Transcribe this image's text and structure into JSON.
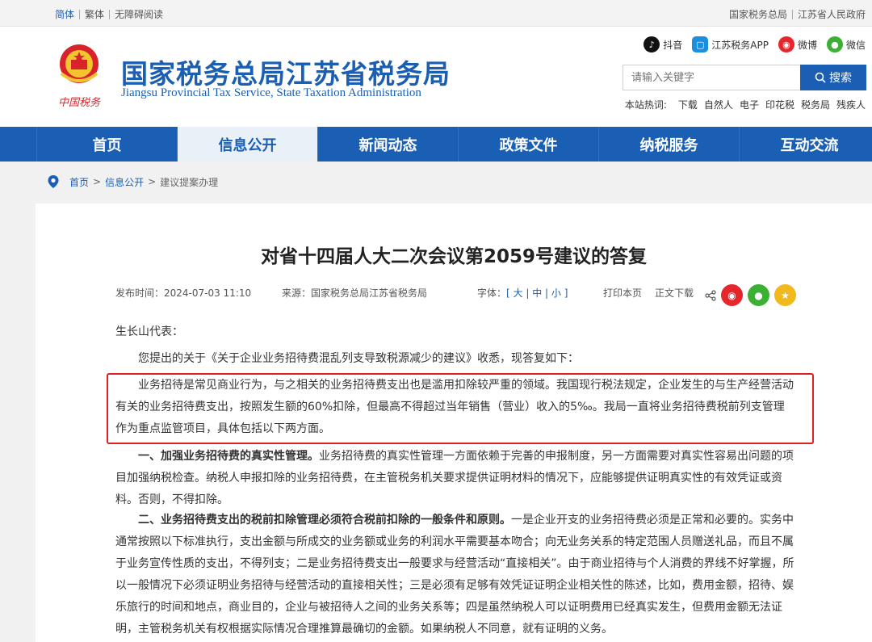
{
  "topbar": {
    "left": [
      "简体",
      "繁体",
      "无障碍阅读"
    ],
    "right": [
      "国家税务总局",
      "江苏省人民政府"
    ]
  },
  "header": {
    "emblem_caption": "中国税务",
    "title": "国家税务总局江苏省税务局",
    "subtitle": "Jiangsu Provincial Tax Service, State Taxation Administration",
    "social": [
      {
        "name": "抖音",
        "icon": "douyin-icon",
        "color": "#111111"
      },
      {
        "name": "江苏税务APP",
        "icon": "app-icon",
        "color": "#1a8fe0"
      },
      {
        "name": "微博",
        "icon": "weibo-icon",
        "color": "#e6262a"
      },
      {
        "name": "微信",
        "icon": "wechat-icon",
        "color": "#3cb034"
      }
    ],
    "search": {
      "placeholder": "请输入关键字",
      "button": "搜索"
    },
    "hot_label": "本站热词:",
    "hot_words": [
      "下载",
      "自然人",
      "电子",
      "印花税",
      "税务局",
      "残疾人"
    ]
  },
  "nav": {
    "items": [
      "首页",
      "信息公开",
      "新闻动态",
      "政策文件",
      "纳税服务",
      "互动交流"
    ],
    "active_index": 1
  },
  "breadcrumb": [
    "首页",
    "信息公开",
    "建议提案办理"
  ],
  "article": {
    "title": "对省十四届人大二次会议第2059号建议的答复",
    "meta": {
      "date": "发布时间：2024-07-03 11:10",
      "source": "来源：国家税务总局江苏省税务局",
      "font_label": "字体：",
      "font_big": "大",
      "font_mid": "中",
      "font_small": "小",
      "print": "打印本页",
      "download": "正文下载"
    },
    "salutation": "生长山代表：",
    "intro": "您提出的关于《关于企业业务招待费混乱列支导致税源减少的建议》收悉，现答复如下：",
    "para1": "业务招待是常见商业行为，与之相关的业务招待费支出也是滥用扣除较严重的领域。我国现行税法规定，企业发生的与生产经营活动有关的业务招待费支出，按照发生额的60%扣除，但最高不得超过当年销售（营业）收入的5‰。我局一直将业务招待费税前列支管理作为重点监管项目，具体包括以下两方面。",
    "para2_bold": "一、加强业务招待费的真实性管理。",
    "para2": "业务招待费的真实性管理一方面依赖于完善的申报制度，另一方面需要对真实性容易出问题的项目加强纳税检查。纳税人申报扣除的业务招待费，在主管税务机关要求提供证明材料的情况下，应能够提供证明真实性的有效凭证或资料。否则，不得扣除。",
    "para3_bold": "二、业务招待费支出的税前扣除管理必须符合税前扣除的一般条件和原则。",
    "para3": "一是企业开支的业务招待费必须是正常和必要的。实务中通常按照以下标准执行，支出金额与所成交的业务额或业务的利润水平需要基本吻合；向无业务关系的特定范围人员赠送礼品，而且不属于业务宣传性质的支出，不得列支；二是业务招待费支出一般要求与经营活动“直接相关”。由于商业招待与个人消费的界线不好掌握，所以一般情况下必须证明业务招待与经营活动的直接相关性；三是必须有足够有效凭证证明企业相关性的陈述，比如，费用金额，招待、娱乐旅行的时间和地点，商业目的，企业与被招待人之间的业务关系等；四是虽然纳税人可以证明费用已经真实发生，但费用金额无法证明，主管税务机关有权根据实际情况合理推算最确切的金额。如果纳税人不同意，就有证明的义务。"
  },
  "colors": {
    "brand": "#1a5fb4",
    "highlight_border": "#e02020"
  }
}
